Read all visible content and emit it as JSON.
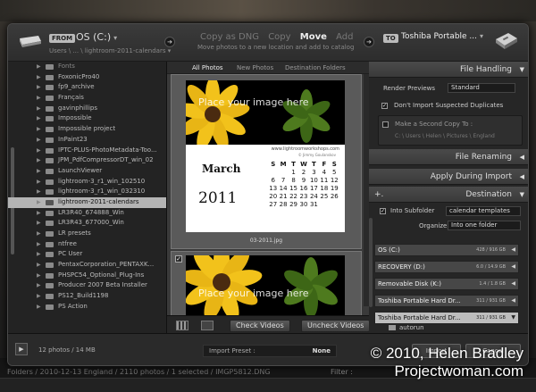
{
  "header": {
    "from_label": "FROM",
    "source": "OS (C:)",
    "source_path": "Users \\ ... \\ lightroom-2011-calendars ▾",
    "modes": [
      "Copy as DNG",
      "Copy",
      "Move",
      "Add"
    ],
    "active_mode": "Move",
    "mode_description": "Move photos to a new location and add to catalog",
    "to_label": "TO",
    "destination": "Toshiba Portable ..."
  },
  "folders": [
    "Fonts",
    "FoxonicPro40",
    "fp9_archive",
    "Français",
    "gavinphillips",
    "Impossible",
    "Impossible project",
    "InPaint23",
    "IPTC-PLUS-PhotoMetadata-Too...",
    "JPM_PdfCompressorDT_win_02",
    "LaunchViewer",
    "lightroom-3_r1_win_102510",
    "lightroom-3_r1_win_032310",
    "lightroom-2011-calendars",
    "LR3R40_674888_Win",
    "LR3R43_677000_Win",
    "LR presets",
    "ntfree",
    "PC User",
    "PentaxCorporation_PENTAXK...",
    "PHSPC54_Optional_Plug-Ins",
    "Producer 2007 Beta Installer",
    "PS12_Build1198",
    "PS Action"
  ],
  "selected_folder_index": 13,
  "grid": {
    "tabs": [
      "All Photos",
      "New Photos",
      "Destination Folders"
    ],
    "active_tab": "All Photos",
    "placeholder_text": "Place your image here",
    "calendar": {
      "site": "www.lightroomworkshops.com",
      "copyright": "© Jimmy Goulanskov",
      "month": "March",
      "year": "2011",
      "day_headers": [
        "S",
        "M",
        "T",
        "W",
        "T",
        "F",
        "S"
      ],
      "days": [
        "",
        "",
        "1",
        "2",
        "3",
        "4",
        "5",
        "6",
        "7",
        "8",
        "9",
        "10",
        "11",
        "12",
        "13",
        "14",
        "15",
        "16",
        "17",
        "18",
        "19",
        "20",
        "21",
        "22",
        "23",
        "24",
        "25",
        "26",
        "27",
        "28",
        "29",
        "30",
        "31",
        "",
        ""
      ]
    },
    "file_name": "03-2011.jpg",
    "check_videos_label": "Check Videos",
    "uncheck_videos_label": "Uncheck Videos"
  },
  "right_panel": {
    "file_handling_title": "File Handling",
    "render_previews_label": "Render Previews",
    "render_previews_value": "Standard",
    "dont_import_label": "Don't Import Suspected Duplicates",
    "second_copy_label": "Make a Second Copy To :",
    "second_copy_path": "C: \\ Users \\ Helen \\ Pictures \\ England",
    "file_renaming_title": "File Renaming",
    "apply_during_import_title": "Apply During Import",
    "destination_title": "Destination",
    "plus_symbol": "+.",
    "into_subfolder_label": "Into Subfolder",
    "subfolder_value": "calendar templates",
    "organize_label": "Organize",
    "organize_value": "Into one folder",
    "drives": [
      {
        "name": "OS (C:)",
        "size": "428 / 916 GB"
      },
      {
        "name": "RECOVERY (D:)",
        "size": "6.0 / 14.9 GB"
      },
      {
        "name": "Removable Disk (K:)",
        "size": "1.4 / 1.8 GB"
      },
      {
        "name": "Toshiba Portable Hard Dr...",
        "size": "311 / 931 GB"
      },
      {
        "name": "Toshiba Portable Hard Dr...",
        "size": "311 / 931 GB"
      }
    ],
    "active_drive_index": 4,
    "subfolder_item": "autorun"
  },
  "footer": {
    "photo_count": "12 photos / 14 MB",
    "import_preset_label": "Import Preset :",
    "import_preset_value": "None",
    "import_button": "Import",
    "cancel_button": "Cancel"
  },
  "background": {
    "path_text": "Folders / 2010-12-13 England / 2110 photos / 1 selected / IMGP5812.DNG",
    "filter_label": "Filter :"
  },
  "watermark": {
    "line1": "© 2010, Helen Bradley",
    "line2": "Projectwoman.com"
  }
}
